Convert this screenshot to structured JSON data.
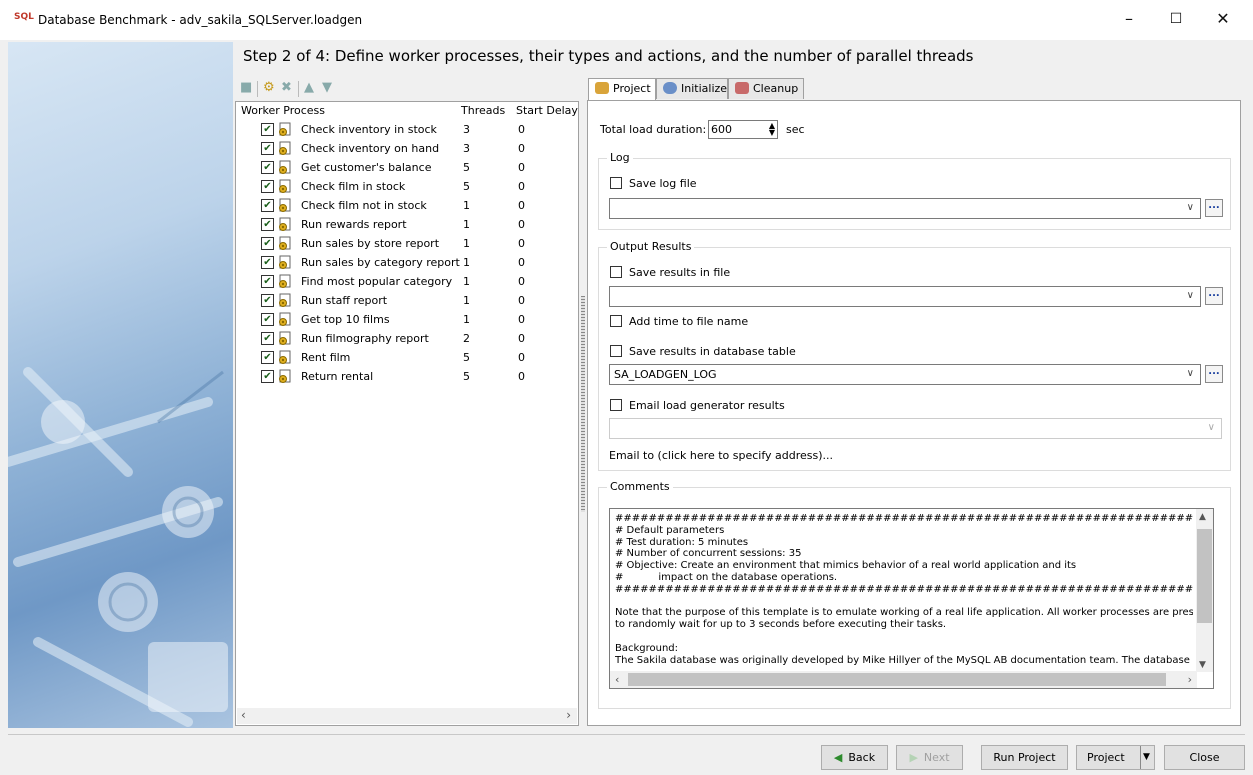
{
  "window": {
    "app_icon_text": "SQL",
    "title": "Database Benchmark - adv_sakila_SQLServer.loadgen",
    "controls": [
      "–",
      "☐",
      "✕"
    ]
  },
  "step_title": "Step 2 of 4:  Define worker processes, their types and actions, and the number of parallel threads",
  "worker_table": {
    "headers": [
      "Worker Process",
      "Threads",
      "Start Delay"
    ],
    "rows": [
      {
        "name": "Check inventory in stock",
        "threads": "3",
        "delay": "0",
        "checked": true
      },
      {
        "name": "Check inventory on hand",
        "threads": "3",
        "delay": "0",
        "checked": true
      },
      {
        "name": "Get customer's balance",
        "threads": "5",
        "delay": "0",
        "checked": true
      },
      {
        "name": "Check film in stock",
        "threads": "5",
        "delay": "0",
        "checked": true
      },
      {
        "name": "Check film not in stock",
        "threads": "1",
        "delay": "0",
        "checked": true
      },
      {
        "name": "Run rewards report",
        "threads": "1",
        "delay": "0",
        "checked": true
      },
      {
        "name": "Run sales by store report",
        "threads": "1",
        "delay": "0",
        "checked": true
      },
      {
        "name": "Run sales by category report",
        "threads": "1",
        "delay": "0",
        "checked": true
      },
      {
        "name": "Find most popular category",
        "threads": "1",
        "delay": "0",
        "checked": true
      },
      {
        "name": "Run staff report",
        "threads": "1",
        "delay": "0",
        "checked": true
      },
      {
        "name": "Get top 10 films",
        "threads": "1",
        "delay": "0",
        "checked": true
      },
      {
        "name": "Run filmography report",
        "threads": "2",
        "delay": "0",
        "checked": true
      },
      {
        "name": "Rent film",
        "threads": "5",
        "delay": "0",
        "checked": true
      },
      {
        "name": "Return rental",
        "threads": "5",
        "delay": "0",
        "checked": true
      }
    ]
  },
  "tabs": [
    {
      "label": "Project",
      "active": true
    },
    {
      "label": "Initialize",
      "active": false
    },
    {
      "label": "Cleanup",
      "active": false
    }
  ],
  "project": {
    "duration_label": "Total load duration:",
    "duration_value": "600",
    "duration_unit": "sec",
    "log_group": "Log",
    "save_log_label": "Save log file",
    "log_path": "",
    "output_group": "Output Results",
    "save_results_file_label": "Save results in file",
    "results_path": "",
    "add_time_label": "Add time to file name",
    "save_db_label": "Save results in database table",
    "db_table": "SA_LOADGEN_LOG",
    "email_label": "Email load generator results",
    "email_value": "",
    "email_to_link": "Email to (click here to specify address)...",
    "comments_group": "Comments",
    "comments_text": "######################################################################\n# Default parameters\n# Test duration: 5 minutes\n# Number of concurrent sessions: 35\n# Objective: Create an environment that mimics behavior of a real world application and its\n#           impact on the database operations.\n######################################################################\n\nNote that the purpose of this template is to emulate working of a real life application. All worker processes are prese\nto randomly wait for up to 3 seconds before executing their tasks.\n\nBackground:\nThe Sakila database was originally developed by Mike Hillyer of the MySQL AB documentation team. The database"
  },
  "buttons": {
    "back": "Back",
    "next": "Next",
    "run": "Run Project",
    "project": "Project",
    "close": "Close"
  },
  "colors": {
    "accent_check": "#1a5e1a",
    "banner_blue": "#6f98c6",
    "nav_arrow_green": "#2e8b2e"
  }
}
